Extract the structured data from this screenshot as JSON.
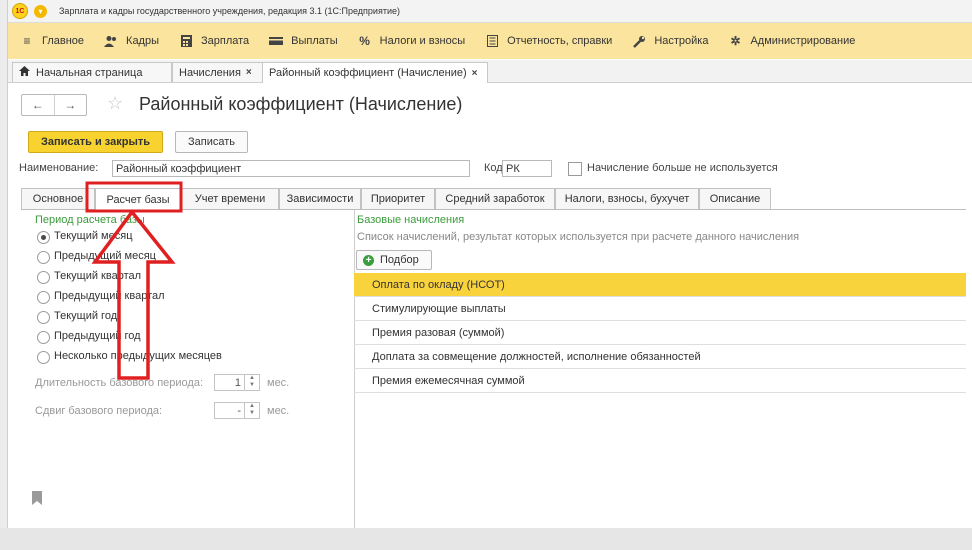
{
  "app": {
    "title": "Зарплата и кадры государственного учреждения, редакция 3.1  (1С:Предприятие)",
    "logo_text": "1С"
  },
  "main_menu": [
    {
      "label": "Главное",
      "icon": "hamburger-icon"
    },
    {
      "label": "Кадры",
      "icon": "people-icon"
    },
    {
      "label": "Зарплата",
      "icon": "calculator-icon"
    },
    {
      "label": "Выплаты",
      "icon": "wallet-icon"
    },
    {
      "label": "Налоги и взносы",
      "icon": "percent-icon"
    },
    {
      "label": "Отчетность, справки",
      "icon": "report-icon"
    },
    {
      "label": "Настройка",
      "icon": "wrench-icon"
    },
    {
      "label": "Администрирование",
      "icon": "gear-icon"
    }
  ],
  "open_tabs": [
    {
      "label": "Начальная страница",
      "icon": "home-icon"
    },
    {
      "label": "Начисления"
    },
    {
      "label": "Районный коэффициент (Начисление)"
    }
  ],
  "form": {
    "title": "Районный коэффициент (Начисление)",
    "save_close_label": "Записать и закрыть",
    "save_label": "Записать",
    "name_label": "Наименование:",
    "name_value": "Районный коэффициент",
    "code_label": "Код:",
    "code_value": "РК",
    "unused_label": "Начисление больше не используется"
  },
  "form_tabs": [
    {
      "label": "Основное"
    },
    {
      "label": "Расчет базы"
    },
    {
      "label": "Учет времени"
    },
    {
      "label": "Зависимости"
    },
    {
      "label": "Приоритет"
    },
    {
      "label": "Средний заработок"
    },
    {
      "label": "Налоги, взносы, бухучет"
    },
    {
      "label": "Описание"
    }
  ],
  "active_tab": "Расчет базы",
  "period": {
    "header": "Период расчета базы",
    "options": [
      "Текущий месяц",
      "Предыдущий месяц",
      "Текущий квартал",
      "Предыдущий квартал",
      "Текущий год",
      "Предыдущий год",
      "Несколько предыдущих месяцев"
    ],
    "selected": "Текущий месяц",
    "duration_label": "Длительность базового периода:",
    "duration_value": "1",
    "duration_unit": "мес.",
    "shift_label": "Сдвиг базового периода:",
    "shift_value": "-",
    "shift_unit": "мес."
  },
  "base": {
    "header": "Базовые начисления",
    "description": "Список начислений, результат которых используется при расчете данного начисления",
    "pick_label": "Подбор",
    "rows": [
      "Оплата по окладу (НСОТ)",
      "Стимулирующие выплаты",
      "Премия разовая (суммой)",
      "Доплата за совмещение должностей, исполнение обязанностей",
      "Премия ежемесячная суммой"
    ],
    "selected_row": "Оплата по окладу (НСОТ)"
  },
  "colors": {
    "accent_yellow": "#f8d330",
    "menu_bg": "#fbe59e",
    "annotation_red": "#e02020",
    "header_green": "#3b9a3b"
  }
}
